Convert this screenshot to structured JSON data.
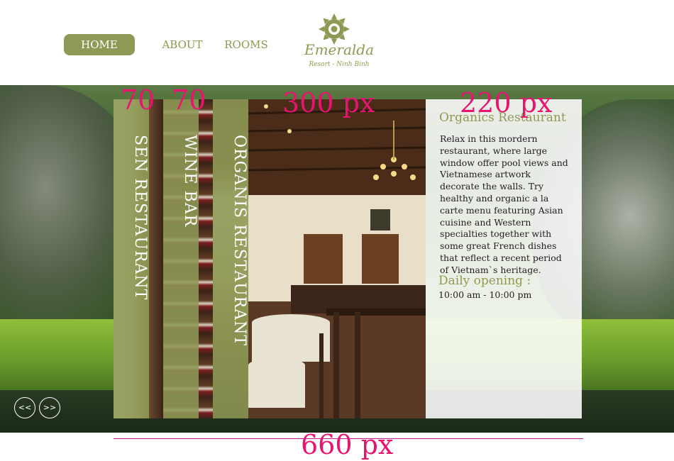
{
  "nav": {
    "home": "HOME",
    "about": "ABOUT",
    "rooms": "ROOMS"
  },
  "logo": {
    "name": "Emeralda",
    "tagline": "Resort - Ninh Binh"
  },
  "slider": {
    "prev": "<<",
    "next": ">>"
  },
  "panels": [
    {
      "label": "SEN RESTAURANT"
    },
    {
      "label": "WINE BAR"
    },
    {
      "label": "ORGANIS RESTAURANT"
    }
  ],
  "info": {
    "title": "Organics Restaurant",
    "body": "Relax in this mordern restaurant, where large window offer pool views and Vietnamese artwork decorate the walls. Try healthy and organic a la carte menu featuring Asian cuisine and Western specialties together with some great French dishes that reflect a recent period of Vietnam`s heritage.",
    "hours_label": "Daily opening :",
    "hours": "10:00 am - 10:00 pm"
  },
  "annotations": {
    "w1": "70",
    "w2": "70",
    "w3": "300 px",
    "w4": "220 px",
    "total": "660 px"
  },
  "colors": {
    "accent": "#8d9a55",
    "annotation": "#e6156f"
  }
}
